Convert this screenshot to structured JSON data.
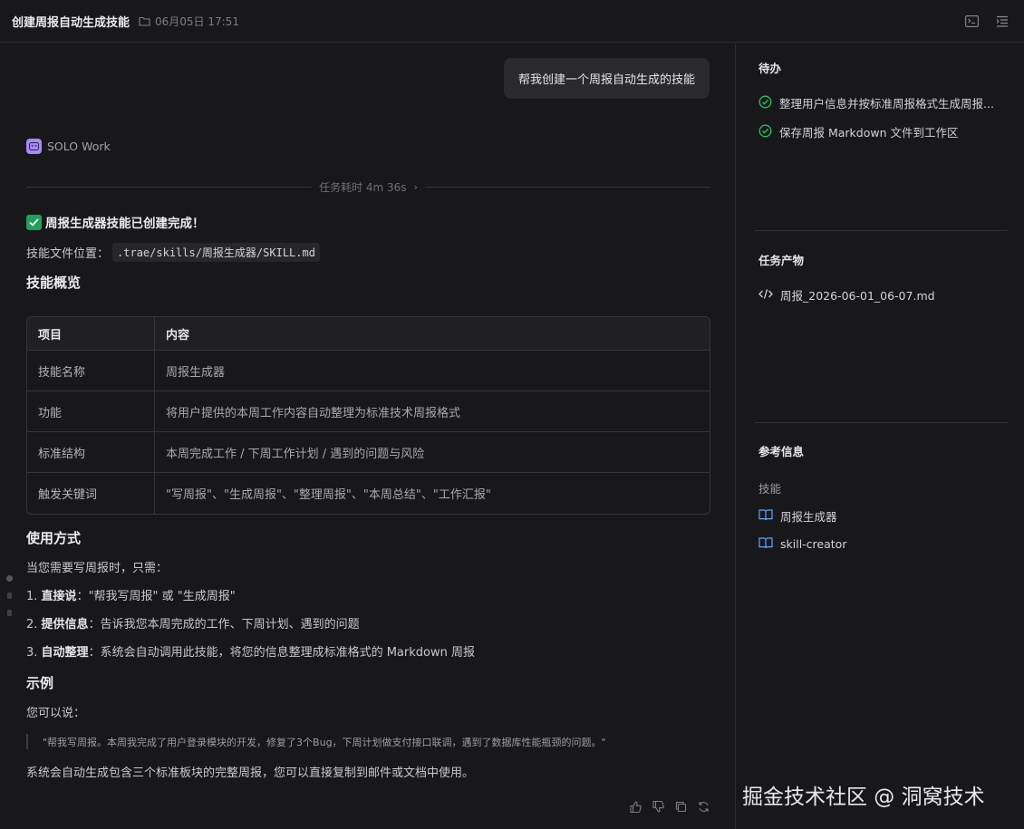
{
  "header": {
    "title": "创建周报自动生成技能",
    "date": "06月05日 17:51"
  },
  "chat": {
    "user_message": "帮我创建一个周报自动生成的技能",
    "agent_name": "SOLO Work",
    "task_duration": "任务耗时 4m 36s",
    "done_title": "周报生成器技能已创建完成！",
    "file_location_label": "技能文件位置：",
    "file_location_path": ".trae/skills/周报生成器/SKILL.md",
    "overview_heading": "技能概览",
    "table": {
      "headers": [
        "项目",
        "内容"
      ],
      "rows": [
        [
          "技能名称",
          "周报生成器"
        ],
        [
          "功能",
          "将用户提供的本周工作内容自动整理为标准技术周报格式"
        ],
        [
          "标准结构",
          "本周完成工作 / 下周工作计划 / 遇到的问题与风险"
        ],
        [
          "触发关键词",
          "\"写周报\"、\"生成周报\"、\"整理周报\"、\"本周总结\"、\"工作汇报\""
        ]
      ]
    },
    "usage_heading": "使用方式",
    "usage_intro": "当您需要写周报时，只需：",
    "steps": [
      {
        "num": "1. ",
        "bold": "直接说",
        "text": "：\"帮我写周报\" 或 \"生成周报\""
      },
      {
        "num": "2. ",
        "bold": "提供信息",
        "text": "：告诉我您本周完成的工作、下周计划、遇到的问题"
      },
      {
        "num": "3. ",
        "bold": "自动整理",
        "text": "：系统会自动调用此技能，将您的信息整理成标准格式的 Markdown 周报"
      }
    ],
    "example_heading": "示例",
    "example_intro": "您可以说：",
    "example_quote": "\"帮我写周报。本周我完成了用户登录模块的开发，修复了3个Bug，下周计划做支付接口联调，遇到了数据库性能瓶颈的问题。\"",
    "closing": "系统会自动生成包含三个标准板块的完整周报，您可以直接复制到邮件或文档中使用。"
  },
  "sidebar": {
    "todo_title": "待办",
    "todos": [
      "整理用户信息并按标准周报格式生成周报...",
      "保存周报 Markdown 文件到工作区"
    ],
    "artifacts_title": "任务产物",
    "artifact_file": "周报_2026-06-01_06-07.md",
    "reference_title": "参考信息",
    "skills_label": "技能",
    "skills": [
      "周报生成器",
      "skill-creator"
    ]
  },
  "watermark": "掘金技术社区 @ 洞窝技术",
  "colors": {
    "background": "#18181b",
    "accent_check": "#22c55e",
    "agent_badge": "#a78bfa",
    "skill_icon": "#60a5fa"
  }
}
